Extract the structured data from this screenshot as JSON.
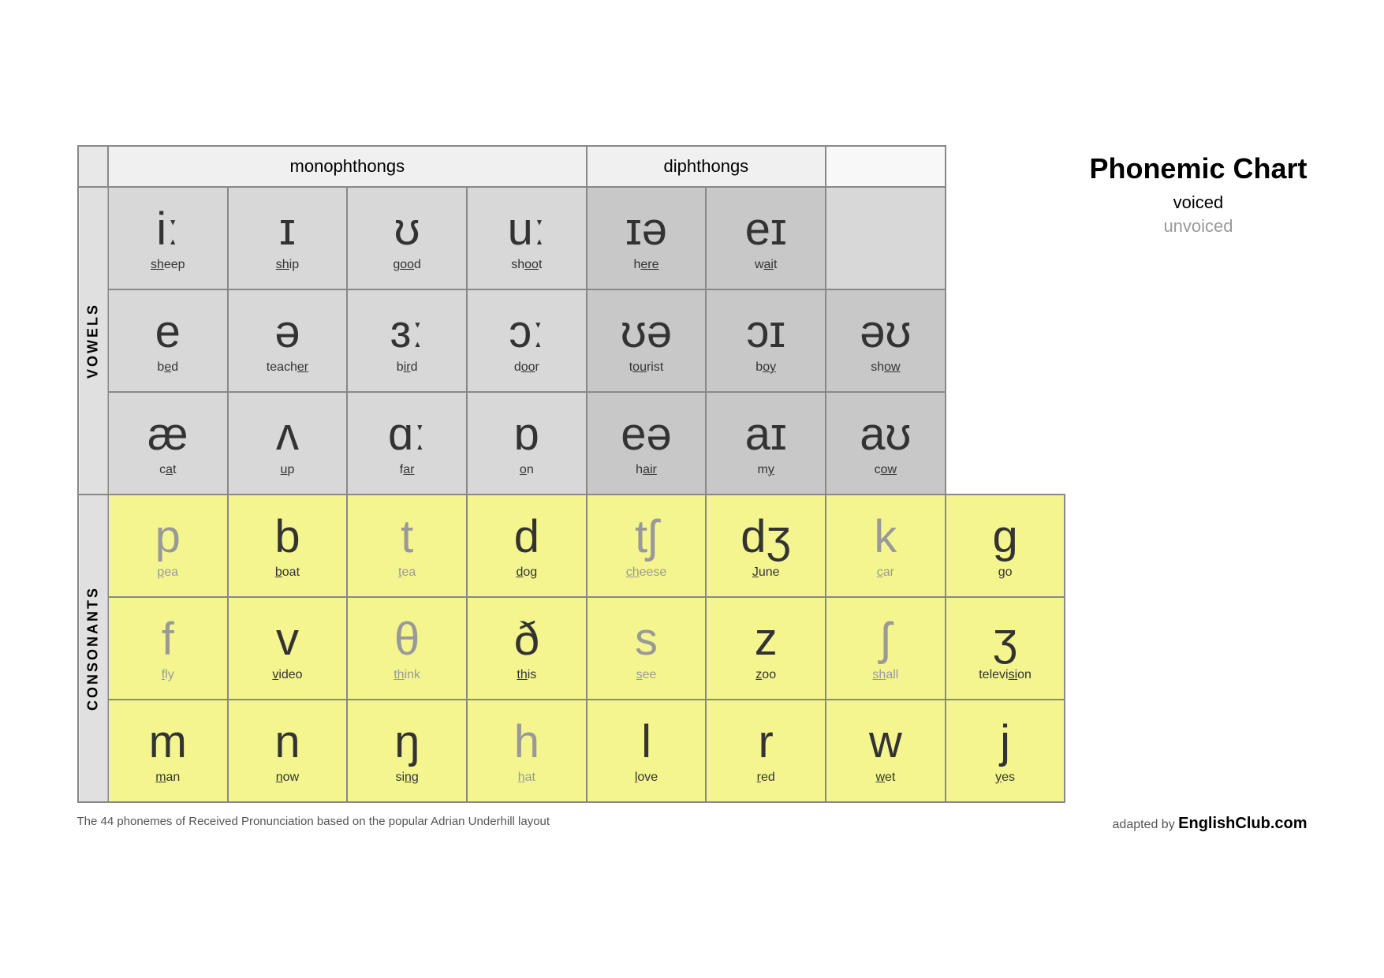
{
  "title": "Phonemic Chart",
  "legend": {
    "voiced": "voiced",
    "unvoiced": "unvoiced"
  },
  "headers": {
    "monophthongs": "monophthongs",
    "diphthongs": "diphthongs"
  },
  "vowels_label": "VOWELS",
  "consonants_label": "CONSONANTS",
  "vowel_rows": [
    [
      {
        "symbol": "iː",
        "word": "sheep",
        "underline": "sh",
        "unvoiced": false
      },
      {
        "symbol": "ɪ",
        "word": "ship",
        "underline": "sh",
        "unvoiced": false
      },
      {
        "symbol": "ʊ",
        "word": "good",
        "underline": "oo",
        "unvoiced": false
      },
      {
        "symbol": "uː",
        "word": "shoot",
        "underline": "oo",
        "unvoiced": false
      },
      {
        "symbol": "ɪə",
        "word": "here",
        "underline": "ere",
        "unvoiced": false
      },
      {
        "symbol": "eɪ",
        "word": "wait",
        "underline": "ai",
        "unvoiced": false
      }
    ],
    [
      {
        "symbol": "e",
        "word": "bed",
        "underline": "e",
        "unvoiced": false
      },
      {
        "symbol": "ə",
        "word": "teacher",
        "underline": "er",
        "unvoiced": false
      },
      {
        "symbol": "ɜː",
        "word": "bird",
        "underline": "ir",
        "unvoiced": false
      },
      {
        "symbol": "ɔː",
        "word": "door",
        "underline": "oo",
        "unvoiced": false
      },
      {
        "symbol": "ʊə",
        "word": "tourist",
        "underline": "ou",
        "unvoiced": false
      },
      {
        "symbol": "ɔɪ",
        "word": "boy",
        "underline": "oy",
        "unvoiced": false
      },
      {
        "symbol": "əʊ",
        "word": "show",
        "underline": "ow",
        "unvoiced": false
      }
    ],
    [
      {
        "symbol": "æ",
        "word": "cat",
        "underline": "a",
        "unvoiced": false
      },
      {
        "symbol": "ʌ",
        "word": "up",
        "underline": "u",
        "unvoiced": false
      },
      {
        "symbol": "ɑː",
        "word": "far",
        "underline": "ar",
        "unvoiced": false
      },
      {
        "symbol": "ɒ",
        "word": "on",
        "underline": "o",
        "unvoiced": false
      },
      {
        "symbol": "eə",
        "word": "hair",
        "underline": "air",
        "unvoiced": false
      },
      {
        "symbol": "aɪ",
        "word": "my",
        "underline": "y",
        "unvoiced": false
      },
      {
        "symbol": "aʊ",
        "word": "cow",
        "underline": "ow",
        "unvoiced": false
      }
    ]
  ],
  "consonant_rows": [
    [
      {
        "symbol": "p",
        "word": "pea",
        "underline": "p",
        "unvoiced": true
      },
      {
        "symbol": "b",
        "word": "boat",
        "underline": "b",
        "unvoiced": false
      },
      {
        "symbol": "t",
        "word": "tea",
        "underline": "t",
        "unvoiced": true
      },
      {
        "symbol": "d",
        "word": "dog",
        "underline": "d",
        "unvoiced": false
      },
      {
        "symbol": "tʃ",
        "word": "cheese",
        "underline": "ch",
        "unvoiced": true
      },
      {
        "symbol": "dʒ",
        "word": "June",
        "underline": "J",
        "unvoiced": false
      },
      {
        "symbol": "k",
        "word": "car",
        "underline": "c",
        "unvoiced": true
      },
      {
        "symbol": "g",
        "word": "go",
        "underline": "g",
        "unvoiced": false
      }
    ],
    [
      {
        "symbol": "f",
        "word": "fly",
        "underline": "f",
        "unvoiced": true
      },
      {
        "symbol": "v",
        "word": "video",
        "underline": "v",
        "unvoiced": false
      },
      {
        "symbol": "θ",
        "word": "think",
        "underline": "th",
        "unvoiced": true
      },
      {
        "symbol": "ð",
        "word": "this",
        "underline": "th",
        "unvoiced": false
      },
      {
        "symbol": "s",
        "word": "see",
        "underline": "s",
        "unvoiced": true
      },
      {
        "symbol": "z",
        "word": "zoo",
        "underline": "z",
        "unvoiced": false
      },
      {
        "symbol": "ʃ",
        "word": "shall",
        "underline": "sh",
        "unvoiced": true
      },
      {
        "symbol": "ʒ",
        "word": "television",
        "underline": "si",
        "unvoiced": false
      }
    ],
    [
      {
        "symbol": "m",
        "word": "man",
        "underline": "m",
        "unvoiced": false
      },
      {
        "symbol": "n",
        "word": "now",
        "underline": "n",
        "unvoiced": false
      },
      {
        "symbol": "ŋ",
        "word": "sing",
        "underline": "ng",
        "unvoiced": false
      },
      {
        "symbol": "h",
        "word": "hat",
        "underline": "h",
        "unvoiced": true
      },
      {
        "symbol": "l",
        "word": "love",
        "underline": "l",
        "unvoiced": false
      },
      {
        "symbol": "r",
        "word": "red",
        "underline": "r",
        "unvoiced": false
      },
      {
        "symbol": "w",
        "word": "wet",
        "underline": "w",
        "unvoiced": false
      },
      {
        "symbol": "j",
        "word": "yes",
        "underline": "y",
        "unvoiced": false
      }
    ]
  ],
  "footer": {
    "description": "The 44 phonemes of Received Pronunciation based on the popular Adrian Underhill layout",
    "credit": "adapted by",
    "brand": "EnglishClub.com"
  }
}
